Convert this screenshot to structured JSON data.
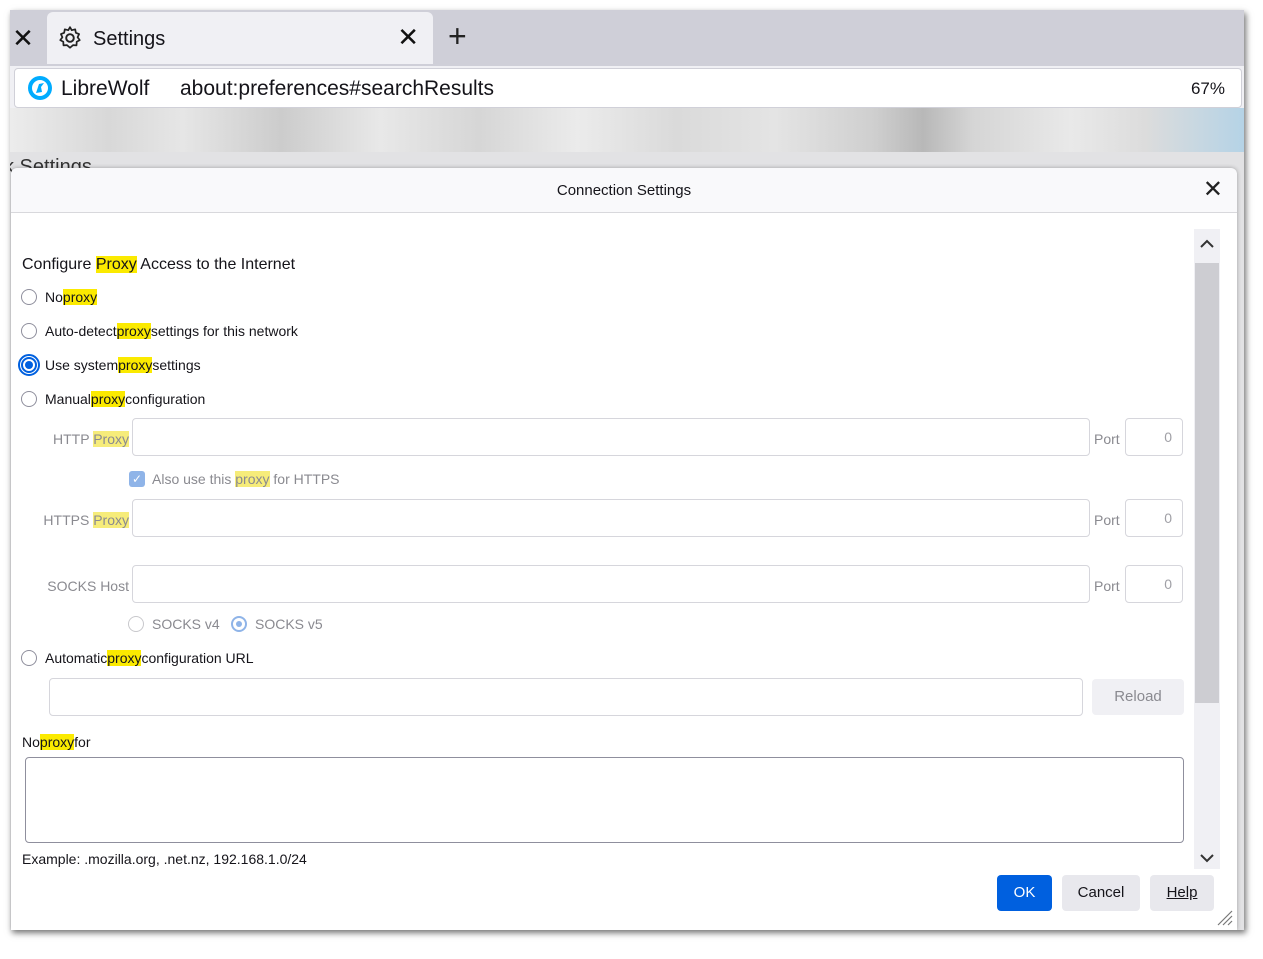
{
  "browser": {
    "prev_tab_close": "✕",
    "tab_title": "Settings",
    "tab_close": "✕",
    "new_tab": "+",
    "brand": "LibreWolf",
    "url": "about:preferences#searchResults",
    "zoom": "67%"
  },
  "background_page": {
    "heading_fragment": "k Settings"
  },
  "dialog": {
    "title": "Connection Settings",
    "close": "✕",
    "heading": {
      "before": "Configure ",
      "highlight": "Proxy",
      "after": " Access to the Internet"
    },
    "options": [
      {
        "before": "No ",
        "highlight": "proxy",
        "after": "",
        "checked": false
      },
      {
        "before": "Auto-detect ",
        "highlight": "proxy",
        "after": " settings for this network",
        "checked": false
      },
      {
        "before": "Use system ",
        "highlight": "proxy",
        "after": " settings",
        "checked": true
      },
      {
        "before": "Manual ",
        "highlight": "proxy",
        "after": " configuration",
        "checked": false
      }
    ],
    "manual": {
      "http_label": "HTTP ",
      "http_label_hl": "Proxy",
      "port_label": "Port",
      "http_port": "0",
      "also_use": {
        "before": "Also use this ",
        "highlight": "proxy",
        "after": " for HTTPS",
        "checked": true
      },
      "https_label": "HTTPS ",
      "https_label_hl": "Proxy",
      "https_port": "0",
      "socks_label": "SOCKS Host",
      "socks_port": "0",
      "socks_v4": "SOCKS v4",
      "socks_v5": "SOCKS v5"
    },
    "auto_url": {
      "before": "Automatic ",
      "highlight": "proxy",
      "after": " configuration URL",
      "checked": false
    },
    "reload_label": "Reload",
    "no_proxy": {
      "before": "No ",
      "highlight": "proxy",
      "after": " for"
    },
    "example": "Example: .mozilla.org, .net.nz, 192.168.1.0/24",
    "buttons": {
      "ok": "OK",
      "cancel": "Cancel",
      "help": "Help"
    },
    "colors": {
      "accent": "#0060df",
      "highlight": "#fbea00"
    }
  }
}
